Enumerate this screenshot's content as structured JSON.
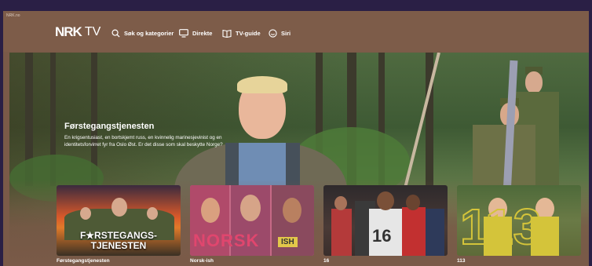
{
  "browser": {
    "url": "NRK.no"
  },
  "header": {
    "logo": {
      "brand": "NRK",
      "product": "TV"
    },
    "nav": [
      {
        "label": "Søk og kategorier",
        "icon": "search-icon"
      },
      {
        "label": "Direkte",
        "icon": "tv-screen-icon"
      },
      {
        "label": "TV-guide",
        "icon": "book-icon"
      },
      {
        "label": "Siri",
        "icon": "profile-smiley-icon"
      }
    ]
  },
  "hero": {
    "title": "Førstegangstjenesten",
    "description": "En krigsentusiast, en bortskjemt russ, en kvinnelig marinesjevinist og en identitetsforvirret fyr fra Oslo Øst. Er det disse som skal beskytte Norge?"
  },
  "cards": [
    {
      "label": "Førstegangstjenesten",
      "art_text": [
        "F★RSTEGANGS-",
        "TJENESTEN"
      ],
      "accent": "#d9592a"
    },
    {
      "label": "Norsk-ish",
      "art_text": [
        "NORSK",
        "ISH"
      ],
      "accent": "#d63d63"
    },
    {
      "label": "16",
      "art_text": [
        "16"
      ],
      "accent": "#3a3a3a"
    },
    {
      "label": "113",
      "art_text": [
        "113"
      ],
      "accent": "#d4c43a"
    }
  ],
  "colors": {
    "background": "#7a5a48",
    "frame": "#2a1f45",
    "text": "#ffffff"
  }
}
